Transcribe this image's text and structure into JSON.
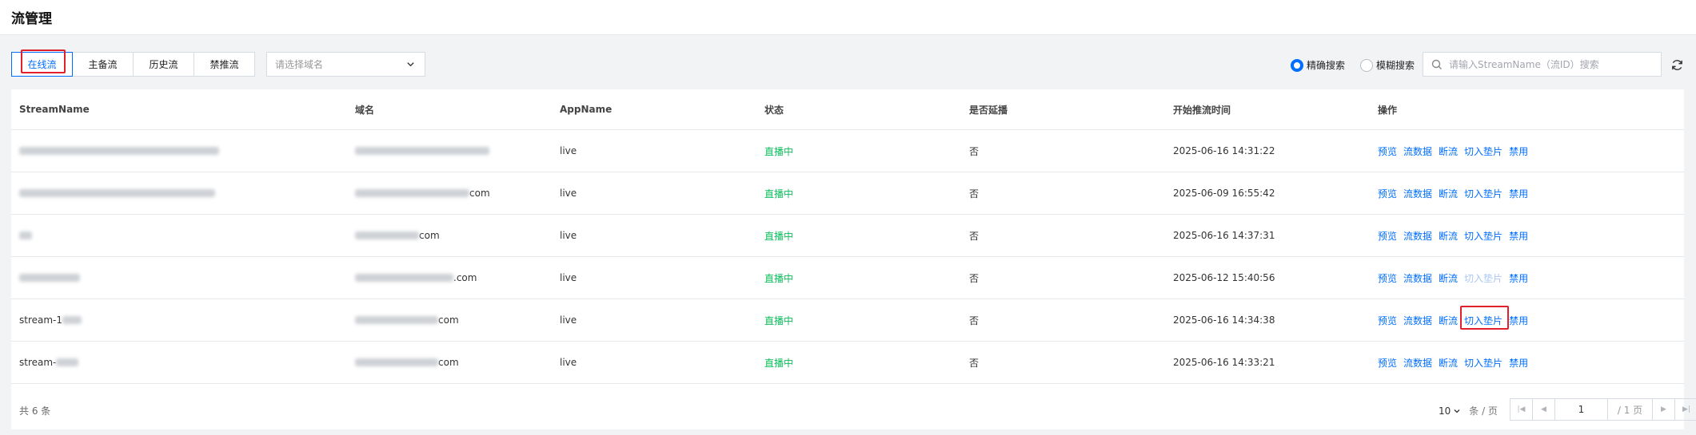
{
  "page": {
    "title": "流管理"
  },
  "filters": {
    "tabs": [
      {
        "label": "在线流",
        "active": true
      },
      {
        "label": "主备流",
        "active": false
      },
      {
        "label": "历史流",
        "active": false
      },
      {
        "label": "禁推流",
        "active": false
      }
    ],
    "domain_placeholder": "请选择域名",
    "search_modes": [
      {
        "label": "精确搜索",
        "checked": true
      },
      {
        "label": "模糊搜索",
        "checked": false
      }
    ],
    "search_placeholder": "请输入StreamName（流ID）搜索"
  },
  "table": {
    "columns": [
      "StreamName",
      "域名",
      "AppName",
      "状态",
      "是否延播",
      "开始推流时间",
      "操作"
    ],
    "rows": [
      {
        "name": "",
        "domain_suffix": "",
        "app": "live",
        "status": "直播中",
        "delay": "否",
        "time": "2025-06-16 14:31:22",
        "ops_slice_disabled": false,
        "slice_highlight": false
      },
      {
        "name": "",
        "domain_suffix": "com",
        "app": "live",
        "status": "直播中",
        "delay": "否",
        "time": "2025-06-09 16:55:42",
        "ops_slice_disabled": false,
        "slice_highlight": false
      },
      {
        "name": "",
        "domain_suffix": "com",
        "app": "live",
        "status": "直播中",
        "delay": "否",
        "time": "2025-06-16 14:37:31",
        "ops_slice_disabled": false,
        "slice_highlight": false
      },
      {
        "name": "",
        "domain_suffix": ".com",
        "app": "live",
        "status": "直播中",
        "delay": "否",
        "time": "2025-06-12 15:40:56",
        "ops_slice_disabled": true,
        "slice_highlight": false
      },
      {
        "name": "stream-1",
        "domain_suffix": "com",
        "app": "live",
        "status": "直播中",
        "delay": "否",
        "time": "2025-06-16 14:34:38",
        "ops_slice_disabled": false,
        "slice_highlight": true
      },
      {
        "name": "stream-",
        "domain_suffix": "com",
        "app": "live",
        "status": "直播中",
        "delay": "否",
        "time": "2025-06-16 14:33:21",
        "ops_slice_disabled": false,
        "slice_highlight": false
      }
    ],
    "ops": [
      "预览",
      "流数据",
      "断流",
      "切入垫片",
      "禁用"
    ]
  },
  "footer": {
    "total": "共 6 条",
    "page_size": "10",
    "page_size_unit": "条 / 页",
    "current_page": "1",
    "total_pages": "/ 1 页"
  },
  "colors": {
    "accent": "#006eff",
    "live": "#0abf5b",
    "highlight": "#e0202a"
  }
}
